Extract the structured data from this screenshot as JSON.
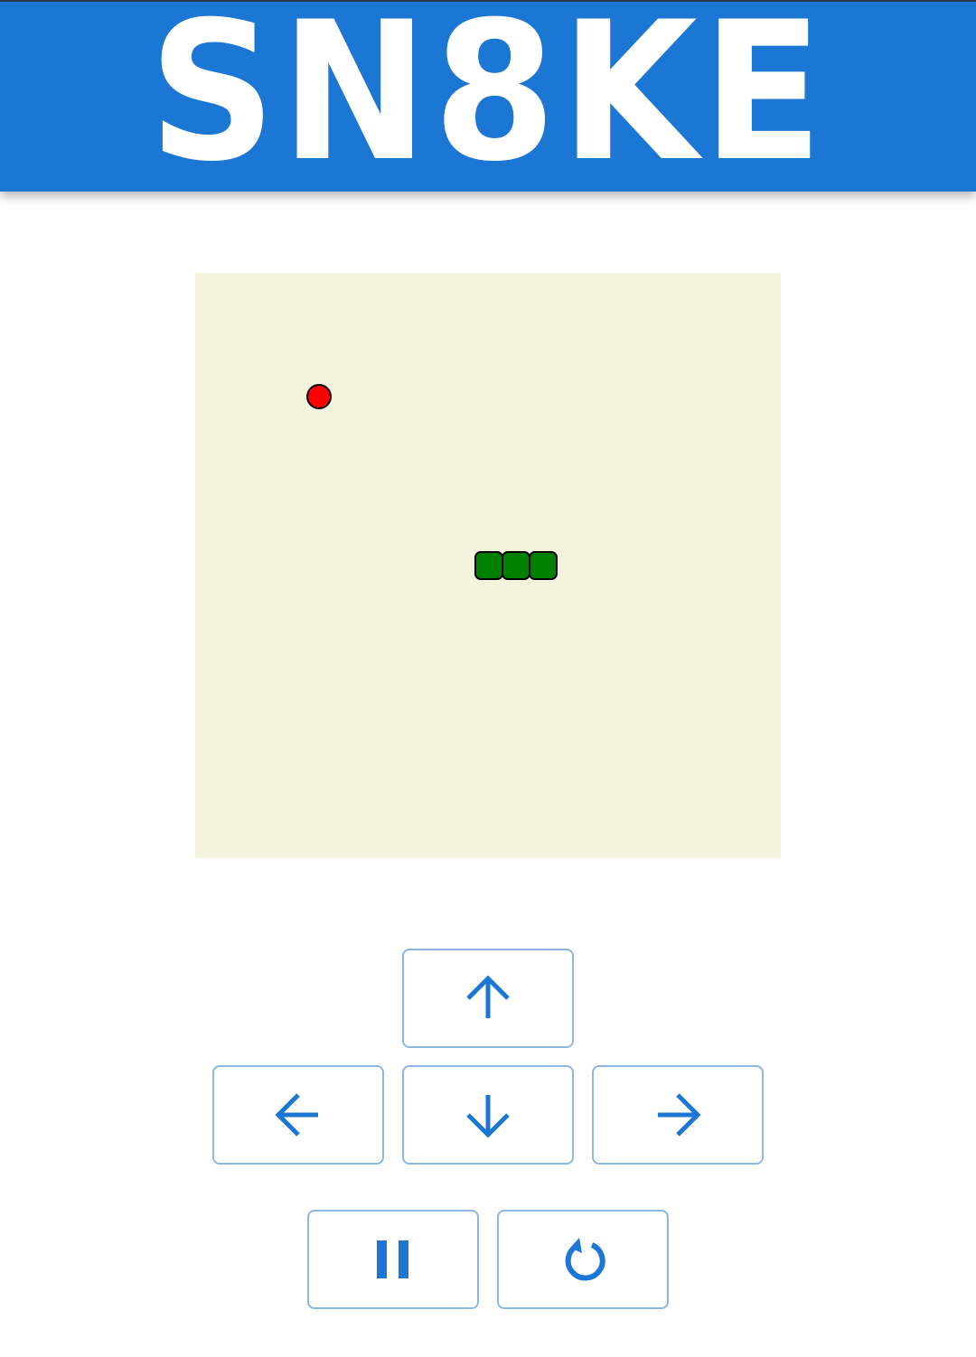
{
  "header": {
    "title": "SN8KE",
    "accent_color": "#1c77d4"
  },
  "board": {
    "background_color": "#f4f4de",
    "food": {
      "color": "#ff0000"
    },
    "snake": {
      "color": "#008000",
      "length": 3
    }
  },
  "controls": {
    "up": {
      "icon": "arrow-up-icon"
    },
    "left": {
      "icon": "arrow-left-icon"
    },
    "down": {
      "icon": "arrow-down-icon"
    },
    "right": {
      "icon": "arrow-right-icon"
    },
    "pause": {
      "icon": "pause-icon"
    },
    "restart": {
      "icon": "restart-icon"
    },
    "icon_color": "#1c77d4"
  }
}
